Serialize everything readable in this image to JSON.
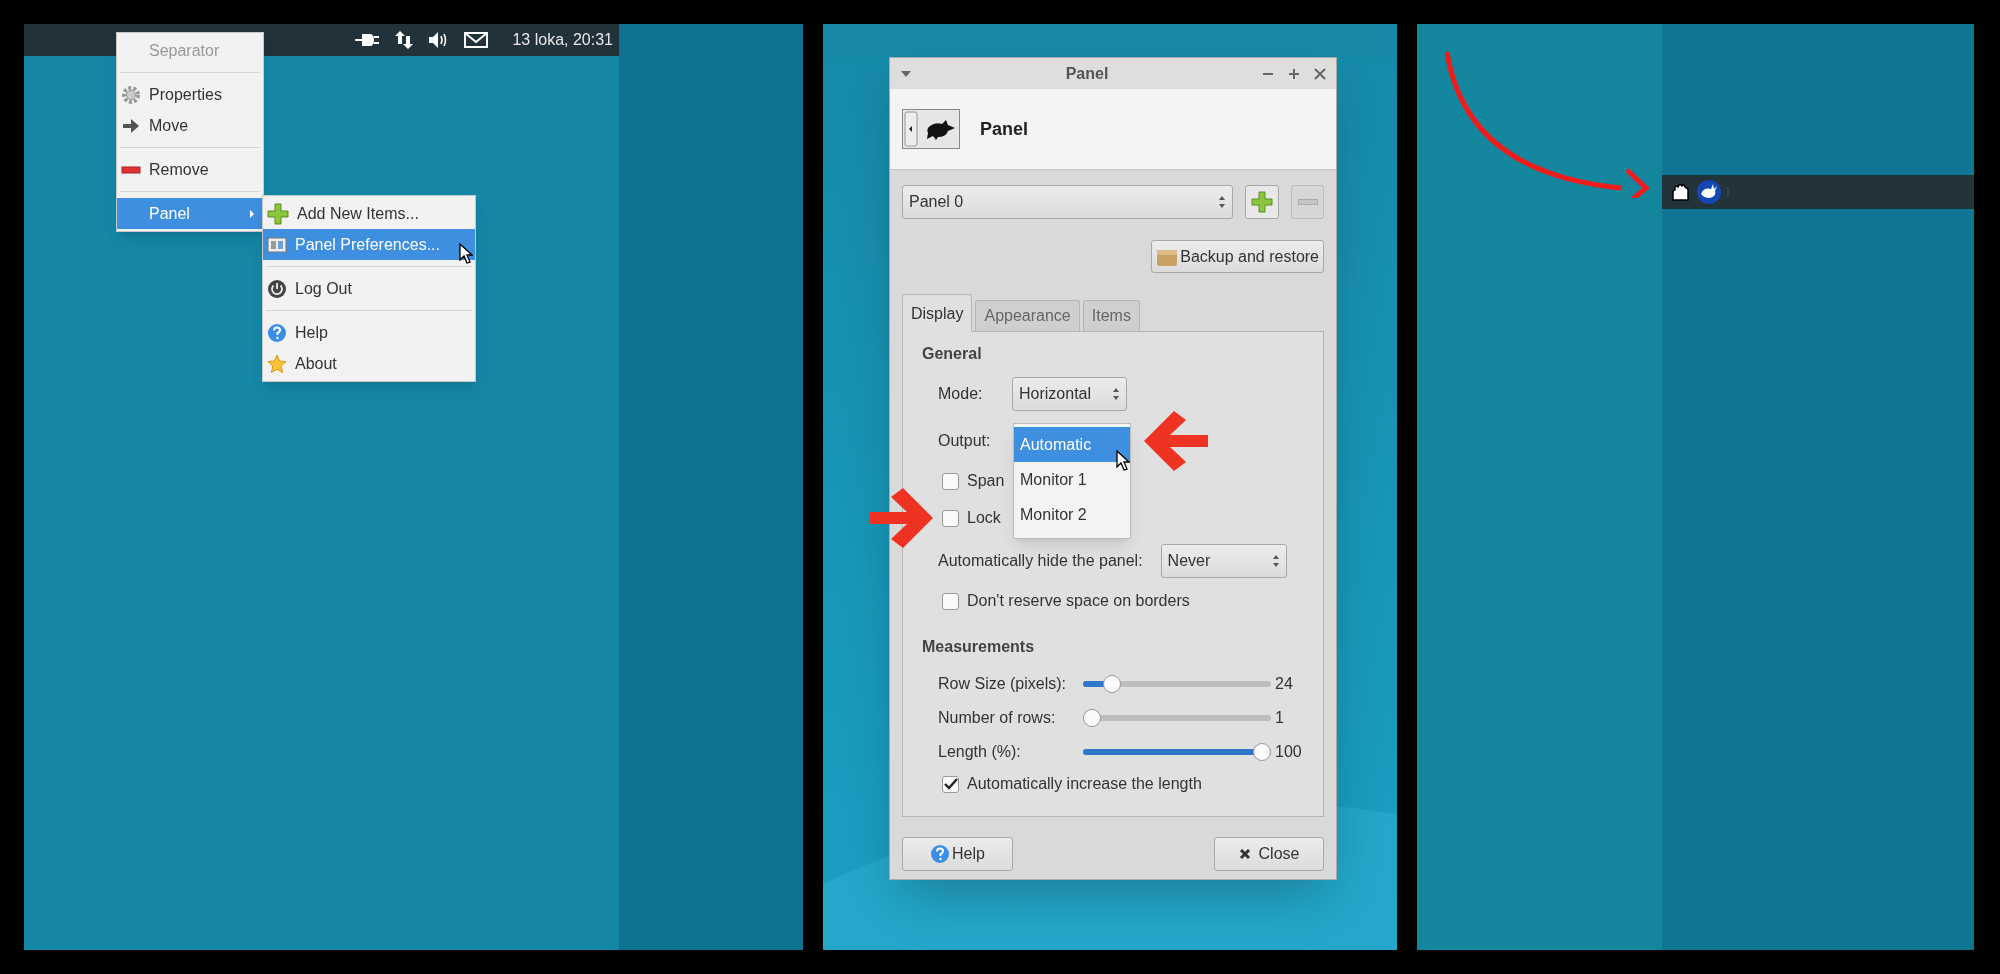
{
  "left_screen": {
    "panel_bar": {
      "clock": "13 loka, 20:31"
    },
    "context_menu": {
      "items": [
        {
          "kind": "item",
          "label": "Separator",
          "disabled": true,
          "selected": false,
          "has_submenu": false
        },
        {
          "kind": "separator"
        },
        {
          "kind": "item",
          "label": "Properties",
          "disabled": false,
          "selected": false,
          "has_submenu": false
        },
        {
          "kind": "item",
          "label": "Move",
          "disabled": false,
          "selected": false,
          "has_submenu": false
        },
        {
          "kind": "separator"
        },
        {
          "kind": "item",
          "label": "Remove",
          "disabled": false,
          "selected": false,
          "has_submenu": false
        },
        {
          "kind": "separator"
        },
        {
          "kind": "item",
          "label": "Panel",
          "disabled": false,
          "selected": true,
          "has_submenu": true
        }
      ]
    },
    "submenu": {
      "items": [
        {
          "kind": "item",
          "label": "Add New Items...",
          "selected": false
        },
        {
          "kind": "item",
          "label": "Panel Preferences...",
          "selected": true
        },
        {
          "kind": "separator"
        },
        {
          "kind": "item",
          "label": "Log Out",
          "selected": false
        },
        {
          "kind": "separator"
        },
        {
          "kind": "item",
          "label": "Help",
          "selected": false
        },
        {
          "kind": "item",
          "label": "About",
          "selected": false
        }
      ]
    }
  },
  "dialog": {
    "title": "Panel",
    "header": "Panel",
    "panel_select": "Panel 0",
    "remove_disabled": true,
    "backup_button": "Backup and restore",
    "tabs": [
      {
        "label": "Display",
        "selected": true
      },
      {
        "label": "Appearance",
        "selected": false
      },
      {
        "label": "Items",
        "selected": false
      }
    ],
    "general": {
      "heading": "General",
      "mode_label": "Mode:",
      "mode_value": "Horizontal",
      "output_label": "Output:",
      "output_options": [
        {
          "label": "Automatic",
          "selected": true
        },
        {
          "label": "Monitor 1",
          "selected": false
        },
        {
          "label": "Monitor 2",
          "selected": false
        }
      ],
      "span_checkbox": {
        "label": "Span",
        "checked": false
      },
      "lock_checkbox": {
        "label": "Lock",
        "checked": false
      },
      "autohide_label": "Automatically hide the panel:",
      "autohide_value": "Never",
      "reserve_checkbox": {
        "label": "Don't reserve space on borders",
        "checked": false
      }
    },
    "measurements": {
      "heading": "Measurements",
      "sliders": [
        {
          "label": "Row Size (pixels):",
          "level": 0.12,
          "reading": "24"
        },
        {
          "label": "Number of rows:",
          "level": 0,
          "reading": "1"
        },
        {
          "label": "Length (%):",
          "level": 1,
          "reading": "100"
        }
      ],
      "increase_checkbox": {
        "label": "Automatically increase the length",
        "checked": true
      }
    },
    "help_button": "Help",
    "close_button": "Close"
  }
}
